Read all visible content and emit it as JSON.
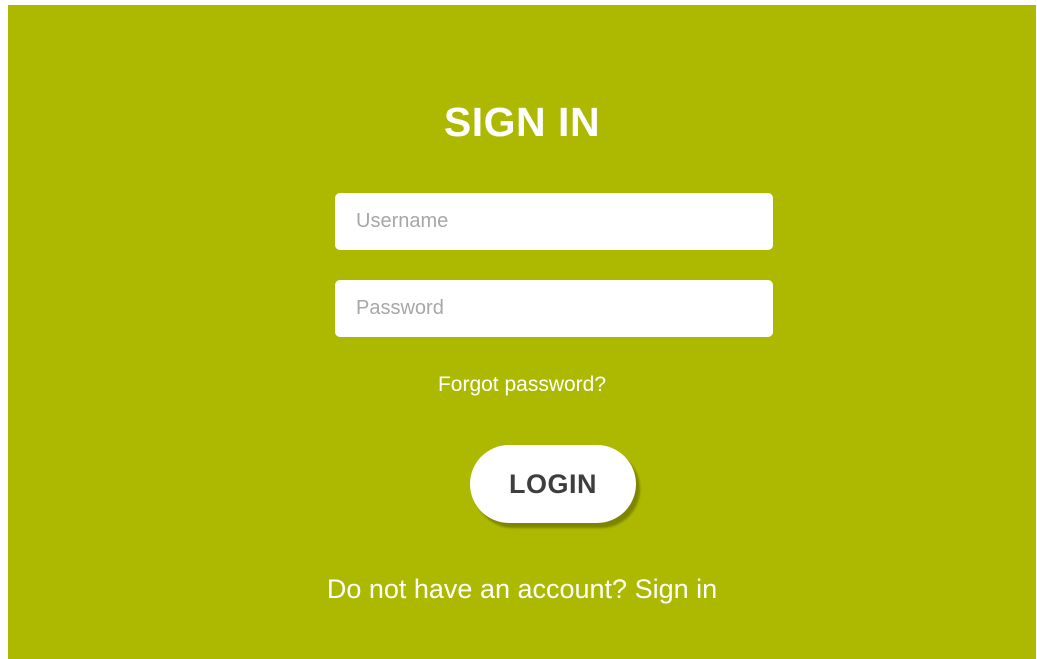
{
  "colors": {
    "panel_background": "#adb900",
    "text_light": "#ffffff",
    "button_text": "#3e3e3e"
  },
  "form": {
    "title": "SIGN IN",
    "username_placeholder": "Username",
    "password_placeholder": "Password",
    "forgot_password": "Forgot password?",
    "login_button": "LOGIN",
    "no_account_text": "Do not have an account?",
    "sign_in_link": "Sign in"
  }
}
